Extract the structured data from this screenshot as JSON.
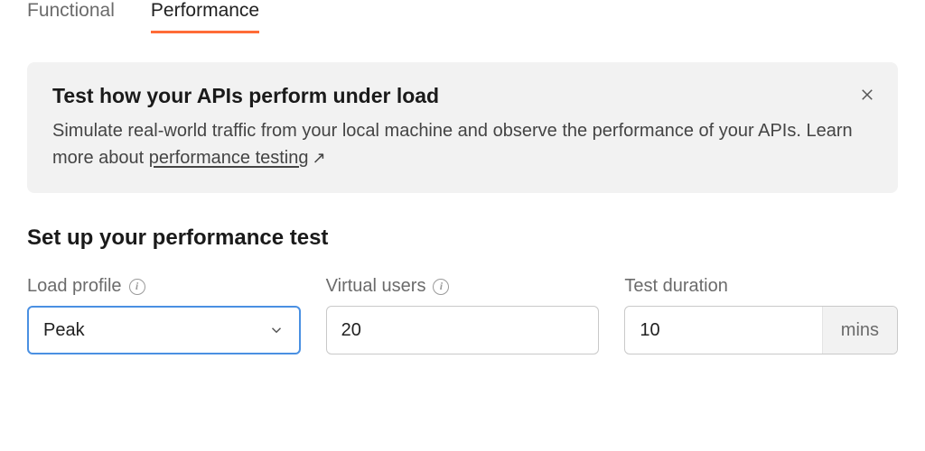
{
  "tabs": {
    "functional": "Functional",
    "performance": "Performance"
  },
  "banner": {
    "title": "Test how your APIs perform under load",
    "desc_prefix": "Simulate real-world traffic from your local machine and observe the performance of your APIs. Learn more about ",
    "link_text": "performance testing"
  },
  "section": {
    "heading": "Set up your performance test"
  },
  "fields": {
    "load_profile": {
      "label": "Load profile",
      "value": "Peak"
    },
    "virtual_users": {
      "label": "Virtual users",
      "value": "20"
    },
    "test_duration": {
      "label": "Test duration",
      "value": "10",
      "unit": "mins"
    }
  }
}
